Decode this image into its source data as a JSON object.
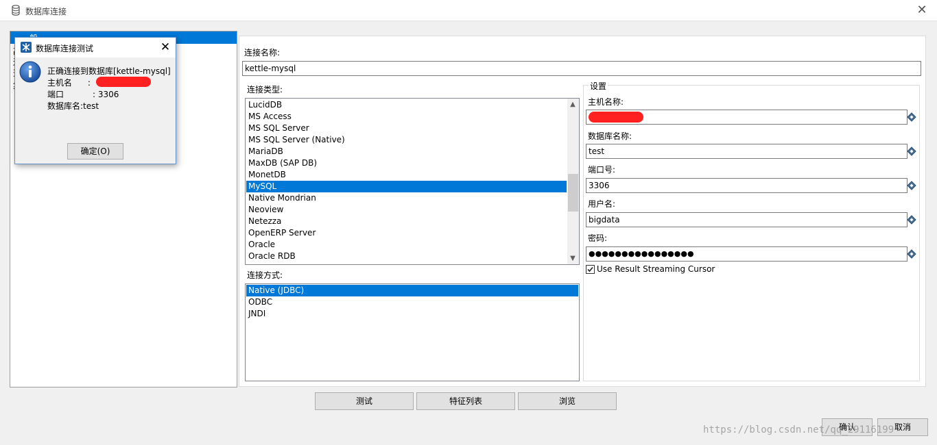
{
  "window": {
    "title": "数据库连接",
    "icon": "database-icon",
    "close_icon": "close-icon"
  },
  "left_panel": {
    "selected_fragment": "一般",
    "fragments": [
      "高",
      "连",
      "选",
      "集"
    ]
  },
  "main": {
    "connection_name_label": "连接名称:",
    "connection_name_value": "kettle-mysql",
    "connection_type_label": "连接类型:",
    "connection_types": [
      {
        "label": "LucidDB",
        "selected": false
      },
      {
        "label": "MS Access",
        "selected": false
      },
      {
        "label": "MS SQL Server",
        "selected": false
      },
      {
        "label": "MS SQL Server (Native)",
        "selected": false
      },
      {
        "label": "MariaDB",
        "selected": false
      },
      {
        "label": "MaxDB (SAP DB)",
        "selected": false
      },
      {
        "label": "MonetDB",
        "selected": false
      },
      {
        "label": "MySQL",
        "selected": true
      },
      {
        "label": "Native Mondrian",
        "selected": false
      },
      {
        "label": "Neoview",
        "selected": false
      },
      {
        "label": "Netezza",
        "selected": false
      },
      {
        "label": "OpenERP Server",
        "selected": false
      },
      {
        "label": "Oracle",
        "selected": false
      },
      {
        "label": "Oracle RDB",
        "selected": false
      }
    ],
    "access_label": "连接方式:",
    "access_methods": [
      {
        "label": "Native (JDBC)",
        "selected": true
      },
      {
        "label": "ODBC",
        "selected": false
      },
      {
        "label": "JNDI",
        "selected": false
      }
    ]
  },
  "settings": {
    "group_label": "设置",
    "host_label": "主机名称:",
    "host_value": "",
    "dbname_label": "数据库名称:",
    "dbname_value": "test",
    "port_label": "端口号:",
    "port_value": "3306",
    "user_label": "用户名:",
    "user_value": "bigdata",
    "password_label": "密码:",
    "password_value": "●●●●●●●●●●●●●●●●",
    "streaming_label": "Use Result Streaming Cursor",
    "streaming_checked": true,
    "variable_icon": "diamond-variable-icon"
  },
  "buttons": {
    "test": "测试",
    "feature_list": "特征列表",
    "explore": "浏览",
    "ok": "确认",
    "cancel": "取消"
  },
  "popup": {
    "title": "数据库连接测试",
    "icon": "kettle-app-icon",
    "info_icon": "info-icon",
    "line1": "正确连接到数据库[kettle-mysql]",
    "line2": "主机名      :",
    "line3": "端口           : 3306",
    "line4": "数据库名:test",
    "ok_label": "确定(O)"
  },
  "watermark": "https://blog.csdn.net/qq_29116199",
  "colors": {
    "selection": "#0078d7",
    "redaction": "#ff2020",
    "button_face": "#e1e1e1"
  }
}
